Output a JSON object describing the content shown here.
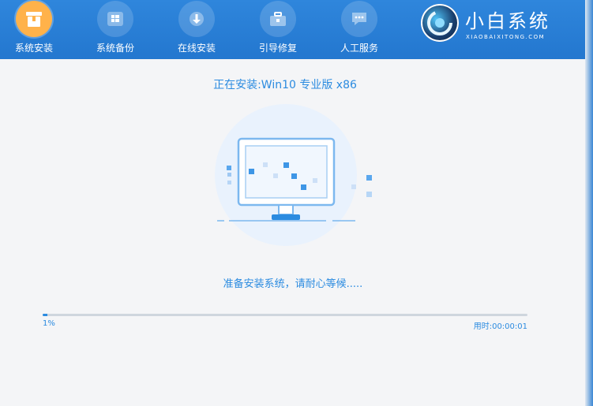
{
  "nav": {
    "items": [
      {
        "label": "系统安装",
        "icon": "box-icon",
        "active": true
      },
      {
        "label": "系统备份",
        "icon": "windows-icon",
        "active": false
      },
      {
        "label": "在线安装",
        "icon": "download-icon",
        "active": false
      },
      {
        "label": "引导修复",
        "icon": "toolbox-icon",
        "active": false
      },
      {
        "label": "人工服务",
        "icon": "chat-icon",
        "active": false
      }
    ]
  },
  "brand": {
    "name": "小白系统",
    "subtitle": "XIAOBAIXITONG.COM"
  },
  "install": {
    "title": "正在安装:Win10 专业版 x86",
    "status": "准备安装系统，请耐心等候.....",
    "progress_percent": 1,
    "progress_label": "1%",
    "elapsed_label": "用时:00:00:01"
  },
  "colors": {
    "header_bg": "#2377cf",
    "accent": "#2b8be0",
    "active_nav": "#ffb24a",
    "background": "#f4f5f7"
  }
}
